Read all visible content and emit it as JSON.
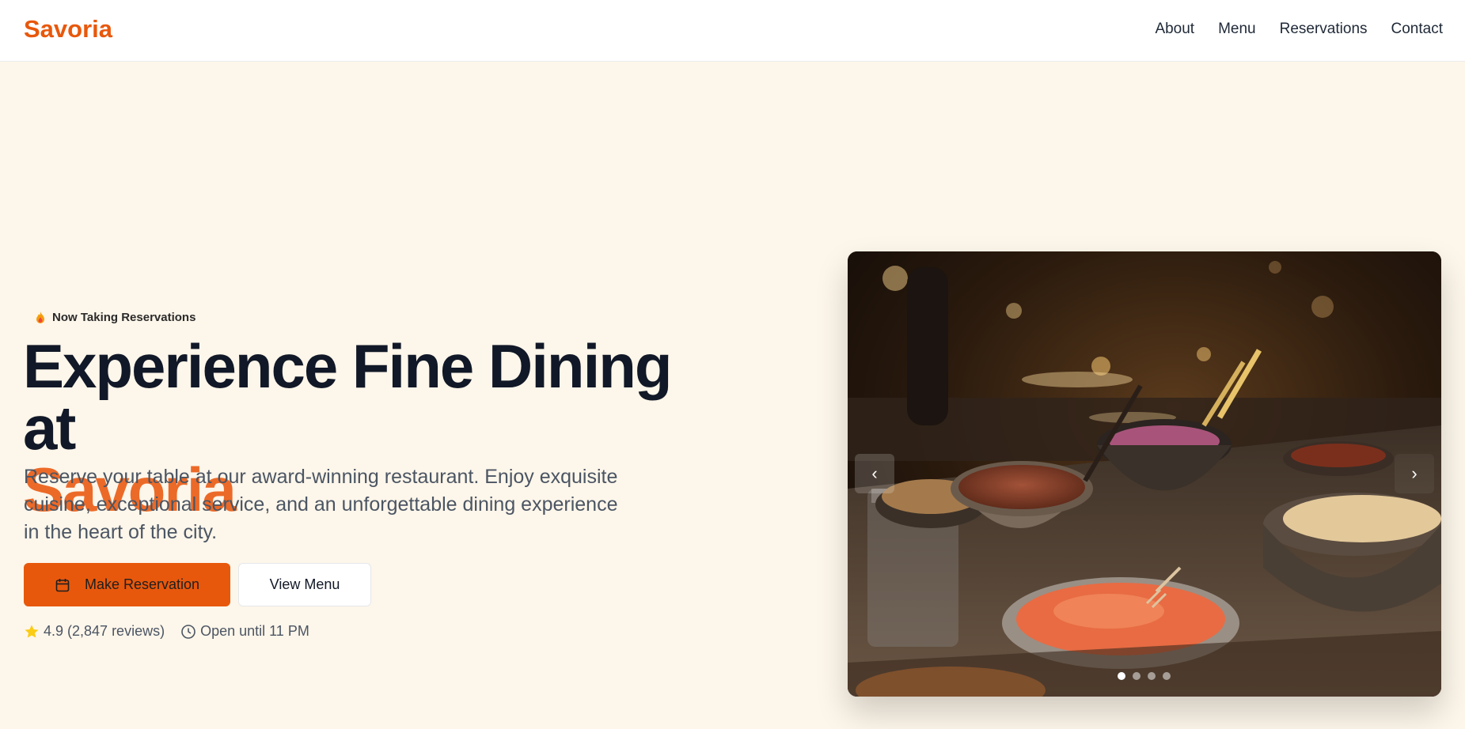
{
  "header": {
    "logo": "Savoria",
    "nav": [
      "About",
      "Menu",
      "Reservations",
      "Contact"
    ]
  },
  "hero": {
    "badge": "Now Taking Reservations",
    "headline_line1": "Experience Fine Dining at",
    "headline_brand": "Savoria",
    "description": "Reserve your table at our award-winning restaurant. Enjoy exquisite cuisine, exceptional service, and an unforgettable dining experience in the heart of the city.",
    "primary_button": "Make Reservation",
    "secondary_button": "View Menu",
    "rating": "4.9 (2,847 reviews)",
    "hours": "Open until 11 PM"
  },
  "carousel": {
    "prev_icon": "‹",
    "next_icon": "›",
    "slide_count": 4,
    "active_slide": 1
  },
  "colors": {
    "accent": "#e8580c",
    "brand_text": "#ec6a28",
    "background": "#fdf6ea",
    "star": "#facc15"
  }
}
